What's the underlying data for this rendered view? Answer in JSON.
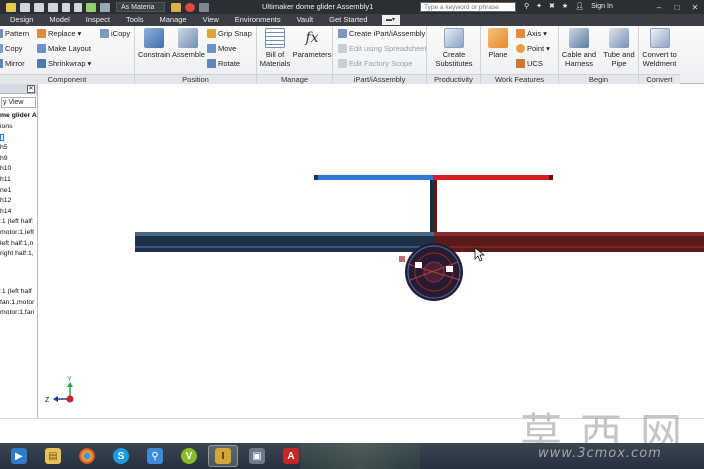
{
  "titlebar": {
    "style_dropdown": "As Materia",
    "app_title": "Ultimaker dome glider Assembly1",
    "search_placeholder": "Type a keyword or phrase",
    "signin": "Sign In"
  },
  "tabs": [
    "Design",
    "Model",
    "Inspect",
    "Tools",
    "Manage",
    "View",
    "Environments",
    "Vault",
    "Get Started"
  ],
  "ribbon": {
    "component": {
      "label": "Component",
      "pattern": "Pattern",
      "copy": "Copy",
      "mirror": "Mirror",
      "replace": "Replace",
      "make_layout": "Make Layout",
      "shrinkwrap": "Shrinkwrap",
      "icopy": "iCopy"
    },
    "position": {
      "label": "Position",
      "constrain": "Constrain",
      "assemble": "Assemble",
      "grip_snap": "Grip Snap",
      "move": "Move",
      "rotate": "Rotate"
    },
    "manage": {
      "label": "Manage",
      "bill_line1": "Bill of",
      "bill_line2": "Materials",
      "parameters": "Parameters"
    },
    "ipart": {
      "label": "iPart/iAssembly",
      "create": "Create iPart/iAssembly",
      "edit_spreadsheet": "Edit using Spreadsheet",
      "edit_factory": "Edit Factory Scope"
    },
    "productivity": {
      "label": "Productivity",
      "create_line1": "Create",
      "create_line2": "Substitutes"
    },
    "work_features": {
      "label": "Work Features",
      "plane": "Plane",
      "axis": "Axis",
      "point": "Point",
      "ucs": "UCS"
    },
    "begin": {
      "label": "Begin",
      "cable_line1": "Cable and",
      "cable_line2": "Harness",
      "tube_line1": "Tube and",
      "tube_line2": "Pipe"
    },
    "convert": {
      "label": "Convert",
      "convert_line1": "Convert to",
      "convert_line2": "Weldment"
    }
  },
  "browser": {
    "view_dropdown": "y View",
    "items": [
      "me glider A",
      "ions",
      "",
      "h5",
      "h9",
      "h10",
      "h11",
      "ne1",
      "h12",
      "h14",
      ":1 (left half:",
      "motor:1,left",
      "left half:1,n",
      "right half:1,",
      "",
      "",
      ":1 (left half",
      "fan:1,motor",
      "motor:1,fan"
    ]
  },
  "viewcube": {
    "y_label": "Y",
    "z_label": "Z"
  },
  "taskbar": {
    "items": [
      "media-player-icon",
      "explorer-icon",
      "chrome-icon",
      "skype-icon",
      "search-app-icon",
      "vuze-icon",
      "inventor-icon",
      "image-viewer-icon",
      "autocad-icon"
    ]
  },
  "watermark": {
    "main": "莫西网",
    "sub": "www.3cmox.com"
  }
}
